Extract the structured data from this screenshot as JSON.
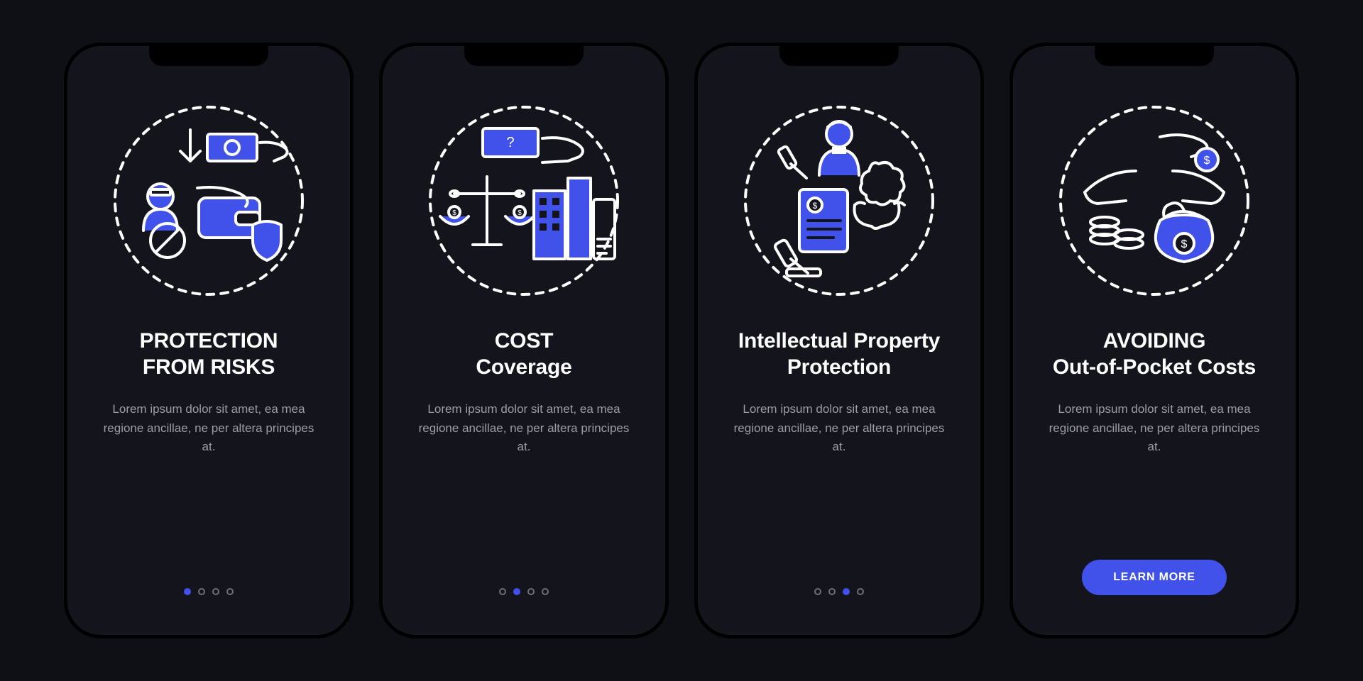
{
  "colors": {
    "bg": "#0f1016",
    "card": "#14151c",
    "accent": "#4052ea",
    "text": "#ffffff",
    "muted": "#9b9da6"
  },
  "screens": [
    {
      "title_line1": "PROTECTION",
      "title_line2": "FROM RISKS",
      "description": "Lorem ipsum dolor sit amet, ea mea regione ancillae, ne per altera principes at.",
      "active_index": 0,
      "show_cta": false,
      "icon": "protection-risks-icon"
    },
    {
      "title_line1": "COST",
      "title_line2": "Coverage",
      "description": "Lorem ipsum dolor sit amet, ea mea regione ancillae, ne per altera principes at.",
      "active_index": 1,
      "show_cta": false,
      "icon": "cost-coverage-icon"
    },
    {
      "title_line1": "Intellectual Property",
      "title_line2": "Protection",
      "description": "Lorem ipsum dolor sit amet, ea mea regione ancillae, ne per altera principes at.",
      "active_index": 2,
      "show_cta": false,
      "icon": "ip-protection-icon"
    },
    {
      "title_line1": "AVOIDING",
      "title_line2": "Out-of-Pocket Costs",
      "description": "Lorem ipsum dolor sit amet, ea mea regione ancillae, ne per altera principes at.",
      "active_index": 3,
      "show_cta": true,
      "icon": "out-of-pocket-icon",
      "cta_label": "LEARN MORE"
    }
  ],
  "dot_count": 4
}
